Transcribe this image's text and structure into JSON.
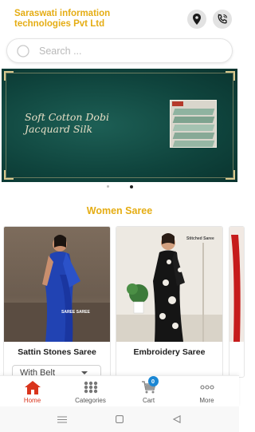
{
  "header": {
    "company_name": "Saraswati information technologies Pvt Ltd",
    "location_icon": "location-pin-icon",
    "call_icon": "phone-call-icon"
  },
  "search": {
    "placeholder": "Search ...",
    "value": ""
  },
  "banner": {
    "line1": "Soft Cotton Dobi",
    "line2": "Jacquard Silk",
    "photo_label": "Soft Cotton Dobi",
    "carousel_count": 2,
    "active_index": 1
  },
  "section": {
    "title": "Women Saree"
  },
  "products": [
    {
      "title": "Sattin Stones Saree",
      "variant": "With Belt",
      "image_tag": "SAREE SAREE",
      "colors": {
        "saree": "#1e3fae",
        "background": "#7a6a5a"
      }
    },
    {
      "title": "Embroidery Saree",
      "variant": "",
      "image_tag": "Stitched Saree",
      "colors": {
        "saree": "#141414",
        "background": "#ece8e0"
      }
    },
    {
      "title": "",
      "variant": "",
      "image_tag": "",
      "colors": {
        "saree": "#c61c1c",
        "background": "#f1e9e3"
      }
    }
  ],
  "bottom_nav": {
    "items": [
      {
        "label": "Home",
        "icon": "home-icon",
        "active": true
      },
      {
        "label": "Categories",
        "icon": "categories-grid-icon",
        "active": false
      },
      {
        "label": "Cart",
        "icon": "cart-icon",
        "active": false,
        "badge": "0"
      },
      {
        "label": "More",
        "icon": "more-dots-icon",
        "active": false
      }
    ]
  },
  "system_nav": {
    "menu_icon": "system-menu-icon",
    "home_icon": "system-home-icon",
    "back_icon": "system-back-icon"
  },
  "colors": {
    "brand": "#e5ad14",
    "active_nav": "#d9341c",
    "banner": "#145049",
    "cart_badge": "#1b87d4"
  }
}
